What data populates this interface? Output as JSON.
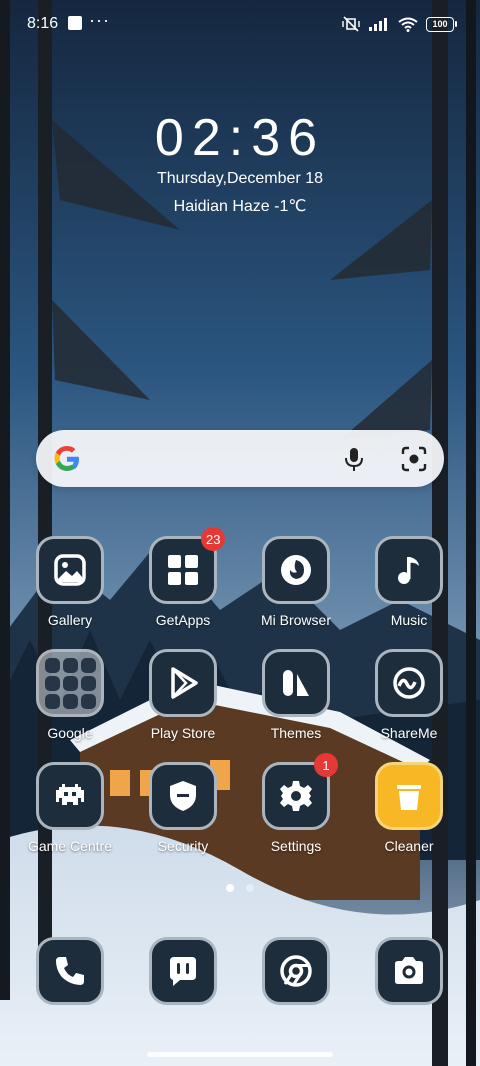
{
  "status_bar": {
    "time": "8:16",
    "more": "···",
    "battery": "100"
  },
  "lock_widget": {
    "clock": "02:36",
    "date": "Thursday,December 18",
    "weather": "Haidian Haze -1℃"
  },
  "search_bar": {
    "icons": [
      "google-logo-icon",
      "mic-icon",
      "lens-icon"
    ]
  },
  "apps": [
    {
      "label": "Gallery",
      "icon": "gallery-icon"
    },
    {
      "label": "GetApps",
      "icon": "grid-icon",
      "badge": "23"
    },
    {
      "label": "Mi Browser",
      "icon": "browser-icon"
    },
    {
      "label": "Music",
      "icon": "music-note-icon"
    },
    {
      "label": "Google",
      "icon": "folder-icon"
    },
    {
      "label": "Play Store",
      "icon": "play-store-icon"
    },
    {
      "label": "Themes",
      "icon": "themes-icon"
    },
    {
      "label": "ShareMe",
      "icon": "shareme-icon"
    },
    {
      "label": "Game Centre",
      "icon": "space-invader-icon"
    },
    {
      "label": "Security",
      "icon": "shield-icon"
    },
    {
      "label": "Settings",
      "icon": "gear-icon",
      "badge": "1"
    },
    {
      "label": "Cleaner",
      "icon": "trash-icon"
    }
  ],
  "page_indicator": {
    "pages": 2,
    "current": 1
  },
  "dock": [
    {
      "icon": "phone-icon"
    },
    {
      "icon": "messages-icon"
    },
    {
      "icon": "chrome-icon"
    },
    {
      "icon": "camera-icon"
    }
  ],
  "colors": {
    "tile_bg": "#1e2d3c",
    "tile_border": "#aab5c0",
    "badge": "#e53935",
    "cleaner": "#f8b725"
  }
}
